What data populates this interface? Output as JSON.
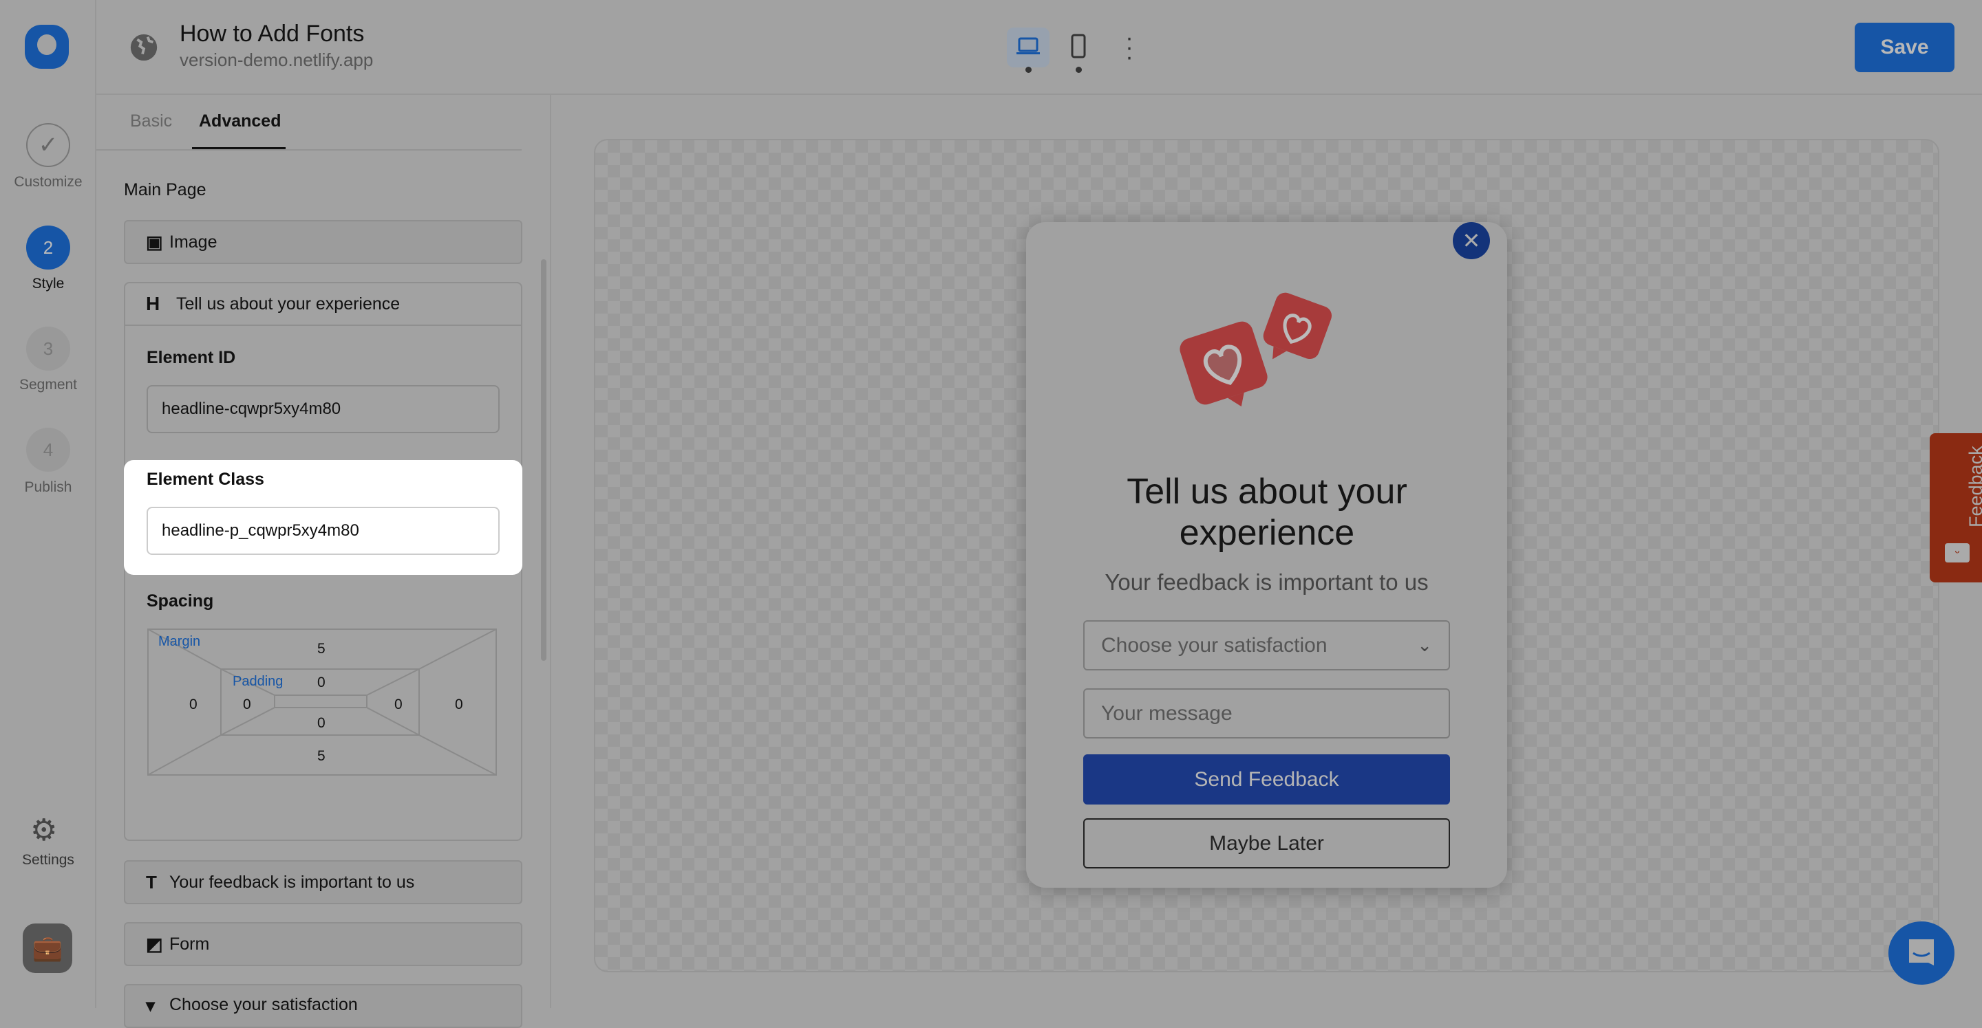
{
  "header": {
    "title": "How to Add Fonts",
    "subtitle": "version-demo.netlify.app",
    "save_label": "Save"
  },
  "rail": {
    "steps": [
      {
        "num": "",
        "label": "Customize",
        "state": "done"
      },
      {
        "num": "2",
        "label": "Style",
        "state": "active"
      },
      {
        "num": "3",
        "label": "Segment",
        "state": "todo"
      },
      {
        "num": "4",
        "label": "Publish",
        "state": "todo"
      }
    ],
    "settings_label": "Settings"
  },
  "panel": {
    "tabs": [
      "Basic",
      "Advanced"
    ],
    "active_tab": "Advanced",
    "section_title": "Main Page",
    "items": [
      {
        "icon": "image-icon",
        "label": "Image"
      },
      {
        "icon": "heading-icon",
        "label": "Tell us about your experience"
      },
      {
        "icon": "text-icon",
        "label": "Your feedback is important to us"
      },
      {
        "icon": "form-icon",
        "label": "Form"
      },
      {
        "icon": "dropdown-icon",
        "label": "Choose your satisfaction"
      }
    ],
    "element_id_label": "Element ID",
    "element_id_value": "headline-cqwpr5xy4m80",
    "element_class_label": "Element Class",
    "element_class_value": "headline-p_cqwpr5xy4m80",
    "spacing_label": "Spacing",
    "margin_label": "Margin",
    "padding_label": "Padding",
    "margin": {
      "top": "5",
      "right": "0",
      "bottom": "5",
      "left": "0"
    },
    "padding": {
      "top": "0",
      "right": "0",
      "bottom": "0",
      "left": "0"
    }
  },
  "popup": {
    "title": "Tell us about your experience",
    "subtitle": "Your feedback is important to us",
    "select_placeholder": "Choose your satisfaction",
    "message_placeholder": "Your message",
    "send_label": "Send Feedback",
    "later_label": "Maybe Later"
  },
  "feedback_tab": "Feedback",
  "colors": {
    "accent": "#1655a6",
    "send": "#1a3785",
    "feedback_tab": "#8a2a12"
  }
}
